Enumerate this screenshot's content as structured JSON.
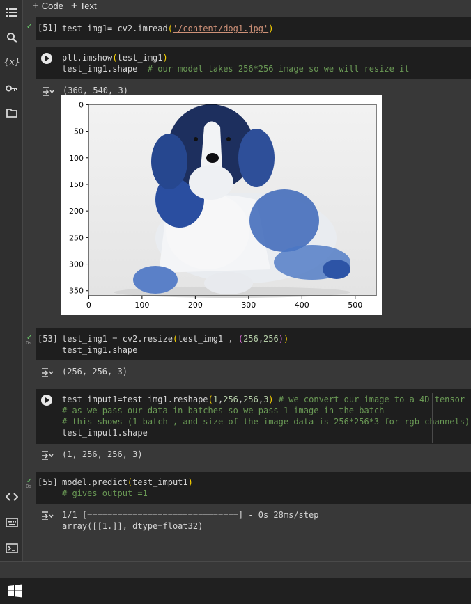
{
  "toolbar": {
    "add_code": "Code",
    "add_text": "Text"
  },
  "rail": {
    "icons": [
      "table-of-contents-icon",
      "search-icon",
      "variables-icon",
      "secrets-key-icon",
      "files-folder-icon",
      "code-snippets-icon",
      "command-palette-icon",
      "terminal-icon"
    ],
    "variables_label": "{x}"
  },
  "cells": [
    {
      "prompt": "[51]",
      "status": "done",
      "code": [
        "test_img1= cv2.imread('/content/dog1.jpg')"
      ]
    },
    {
      "prompt": "",
      "status": "run",
      "code": [
        "plt.imshow(test_img1)",
        "test_img1.shape  # our model takes 256*256 image so we will resize it"
      ],
      "output": "(360, 540, 3)"
    },
    {
      "prompt": "[53]",
      "status": "done",
      "exec_time": "0s",
      "code": [
        "test_img1 = cv2.resize(test_img1 , (256,256))",
        "test_img1.shape"
      ],
      "output": "(256, 256, 3)"
    },
    {
      "prompt": "",
      "status": "run",
      "code": [
        "test_imput1=test_img1.reshape(1,256,256,3) # we convert our image to a 4D tensor",
        "# as we pass our data in batches so we pass 1 image in the batch",
        "# this shows (1 batch , and size of the image data is 256*256*3 for rgb channels)",
        "test_imput1.shape"
      ],
      "output": "(1, 256, 256, 3)"
    },
    {
      "prompt": "[55]",
      "status": "done",
      "exec_time": "0s",
      "code": [
        "model.predict(test_imput1)",
        "# gives output =1"
      ],
      "output_lines": [
        "1/1 [==============================] - 0s 28ms/step",
        "array([[1.]], dtype=float32)"
      ]
    }
  ],
  "plot": {
    "image_alt": "Saint Bernard dog lying down (blue-tinted)",
    "y_ticks": [
      "0",
      "50",
      "100",
      "150",
      "200",
      "250",
      "300",
      "350"
    ],
    "x_ticks": [
      "0",
      "100",
      "200",
      "300",
      "400",
      "500"
    ]
  },
  "colors": {
    "cell_bg": "#1e1e1e",
    "page_bg": "#383838",
    "comment": "#6a9955",
    "string": "#ce9178",
    "number": "#b5cea8",
    "check": "#6ccf6c"
  }
}
